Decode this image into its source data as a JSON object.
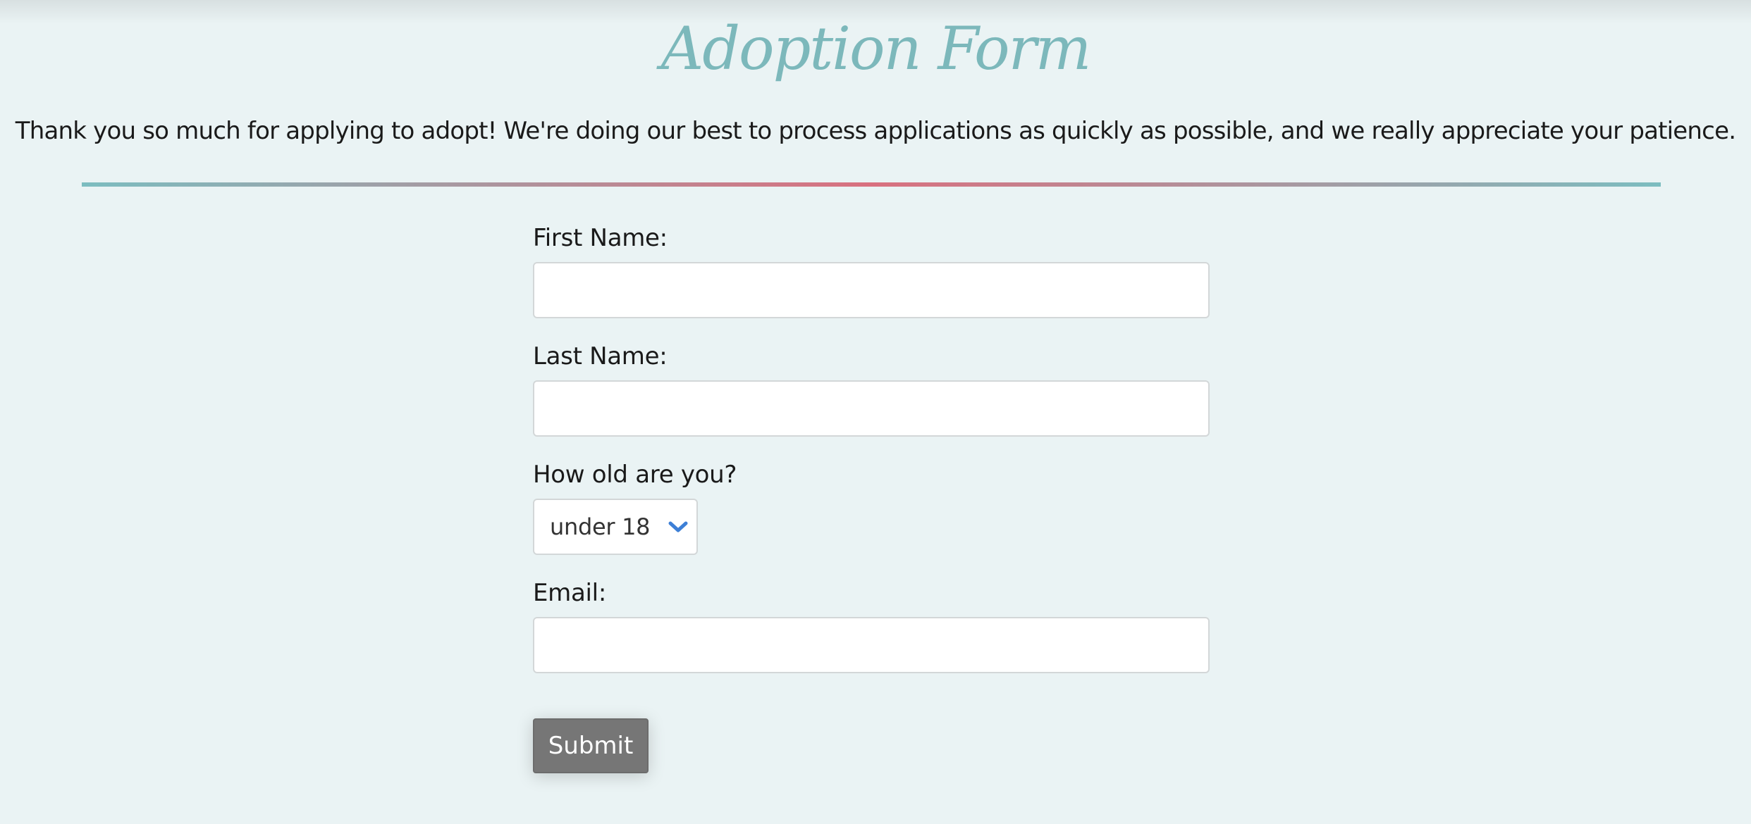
{
  "page": {
    "title": "Adoption Form",
    "intro": "Thank you so much for applying to adopt! We're doing our best to process applications as quickly as possible, and we really appreciate your patience."
  },
  "colors": {
    "title": "#7cb8bb",
    "background": "#eaf3f4",
    "divider_edge": "#7cbdc0",
    "divider_center": "#d9707f",
    "submit_bg": "#767676",
    "chevron": "#3d7fd6"
  },
  "form": {
    "first_name": {
      "label": "First Name:",
      "value": "",
      "placeholder": ""
    },
    "last_name": {
      "label": "Last Name:",
      "value": "",
      "placeholder": ""
    },
    "age": {
      "label": "How old are you?",
      "selected": "under 18",
      "icon": "chevron-down-icon"
    },
    "email": {
      "label": "Email:",
      "value": "",
      "placeholder": ""
    },
    "submit_label": "Submit"
  }
}
